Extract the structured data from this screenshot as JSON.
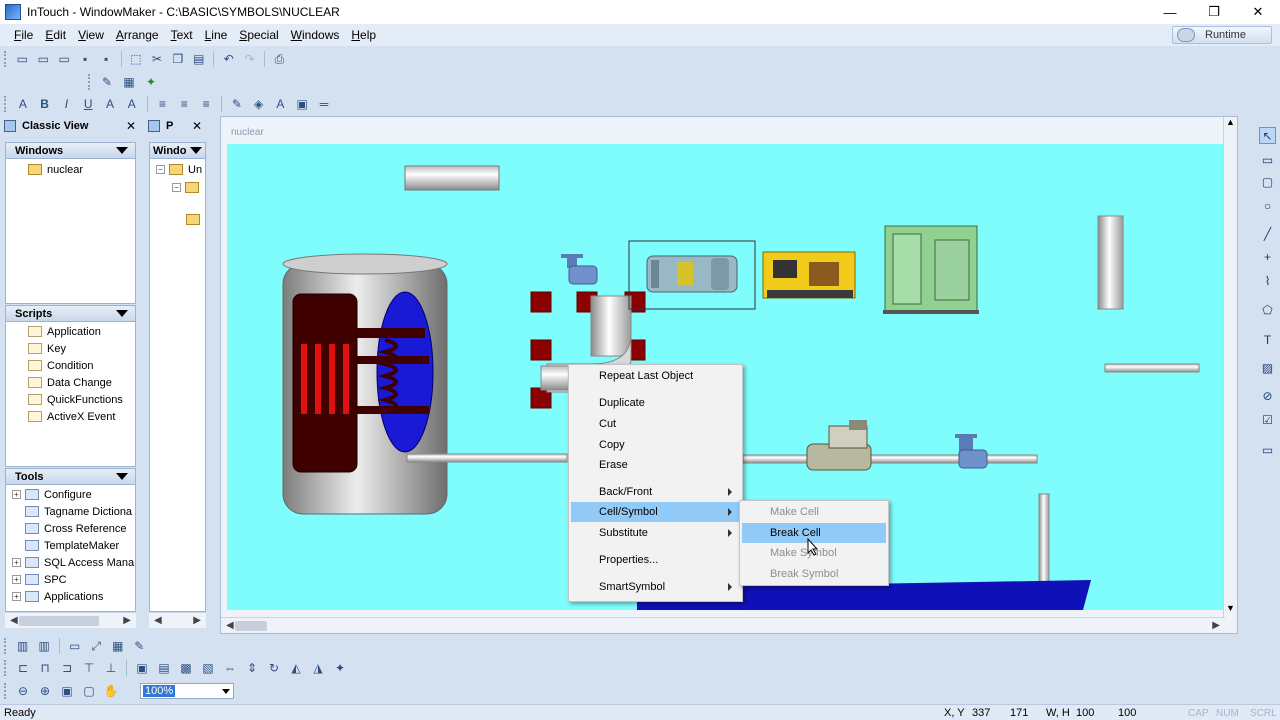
{
  "window": {
    "title": "InTouch - WindowMaker - C:\\BASIC\\SYMBOLS\\NUCLEAR"
  },
  "menubar": {
    "items": [
      {
        "label": "File",
        "key": "F",
        "rest": "ile"
      },
      {
        "label": "Edit",
        "key": "E",
        "rest": "dit"
      },
      {
        "label": "View",
        "key": "V",
        "rest": "iew"
      },
      {
        "label": "Arrange",
        "key": "A",
        "rest": "rrange"
      },
      {
        "label": "Text",
        "key": "T",
        "rest": "ext"
      },
      {
        "label": "Line",
        "key": "L",
        "rest": "ine"
      },
      {
        "label": "Special",
        "key": "S",
        "rest": "pecial"
      },
      {
        "label": "Windows",
        "key": "W",
        "rest": "indows"
      },
      {
        "label": "Help",
        "key": "H",
        "rest": "elp"
      }
    ],
    "runtime_label": "Runtime"
  },
  "classic_view": {
    "title": "Classic View",
    "windows_header": "Windows",
    "windows": [
      "nuclear"
    ],
    "scripts_header": "Scripts",
    "scripts": [
      "Application",
      "Key",
      "Condition",
      "Data Change",
      "QuickFunctions",
      "ActiveX Event"
    ],
    "tools_header": "Tools",
    "tools": [
      "Configure",
      "Tagname Dictiona",
      "Cross Reference",
      "TemplateMaker",
      "SQL Access Mana",
      "SPC",
      "Applications"
    ]
  },
  "project_view": {
    "title": "P",
    "header": "Windo",
    "root": "Un"
  },
  "canvas": {
    "title": "nuclear"
  },
  "context_menu": {
    "items": [
      "Repeat Last Object",
      "Duplicate",
      "Cut",
      "Copy",
      "Erase",
      "Back/Front",
      "Cell/Symbol",
      "Substitute",
      "Properties...",
      "SmartSymbol"
    ],
    "selected": "Cell/Symbol"
  },
  "submenu": {
    "items": [
      "Make Cell",
      "Break Cell",
      "Make Symbol",
      "Break Symbol"
    ],
    "selected": "Break Cell",
    "disabled": [
      "Make Cell",
      "Make Symbol",
      "Break Symbol"
    ]
  },
  "zoom": {
    "value": "100%"
  },
  "statusbar": {
    "status": "Ready",
    "xy_label": "X, Y",
    "x": "337",
    "y": "171",
    "wh_label": "W, H",
    "w": "100",
    "h": "100",
    "indicators": [
      "CAP",
      "NUM",
      "SCRL"
    ]
  },
  "colors": {
    "canvas_bg": "#7ffdfc",
    "reactor_red": "#3f0000",
    "reactor_blue": "#1a1ad6",
    "valve_red": "#8b0000",
    "water_blue": "#1010b8",
    "menu_highlight": "#91c9f7"
  }
}
